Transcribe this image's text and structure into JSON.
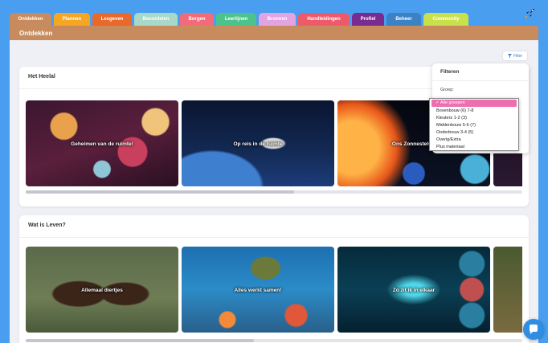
{
  "tabs": [
    {
      "label": "Ontdekken",
      "color": "#c78b5d"
    },
    {
      "label": "Plannen",
      "color": "#f5a623"
    },
    {
      "label": "Lesgeven",
      "color": "#e8692a"
    },
    {
      "label": "Beoordelen",
      "color": "#a8d9c8"
    },
    {
      "label": "Borgen",
      "color": "#f26b7a"
    },
    {
      "label": "Leerlijnen",
      "color": "#4cc38a"
    },
    {
      "label": "Bronnen",
      "color": "#e2a4e0"
    },
    {
      "label": "Handleidingen",
      "color": "#ee5a6a"
    },
    {
      "label": "Profiel",
      "color": "#7a2b8f"
    },
    {
      "label": "Beheer",
      "color": "#3b82c4"
    },
    {
      "label": "Community",
      "color": "#c8e04a"
    }
  ],
  "header": {
    "title": "Ontdekken"
  },
  "filter_button": {
    "label": "Filter"
  },
  "filter_panel": {
    "title": "Filteren",
    "group_label": "Groep:",
    "options": [
      "Alle groepen",
      "Bovenbouw (6) 7-8",
      "Kleuters 1-2 (3)",
      "Middenbouw 5-6 (7)",
      "Onderbouw 3-4 (5)",
      "Overig/Extra",
      "Plus materiaal"
    ],
    "selected": "Alle groepen"
  },
  "sections": [
    {
      "title": "Het Heelal",
      "cards": [
        "Geheimen van de ruimte!",
        "Op reis in de ruimte",
        "Ons Zonnestelsel",
        ""
      ],
      "scroll_fraction": 0.54
    },
    {
      "title": "Wat is Leven?",
      "cards": [
        "Allemaal diertjes",
        "Alles werkt samen!",
        "Zo zit ik in elkaar",
        ""
      ],
      "scroll_fraction": 0.46
    }
  ],
  "icons": {
    "logo": "rocket-icon",
    "chat": "chat-bubble-icon",
    "filter": "funnel-icon"
  }
}
